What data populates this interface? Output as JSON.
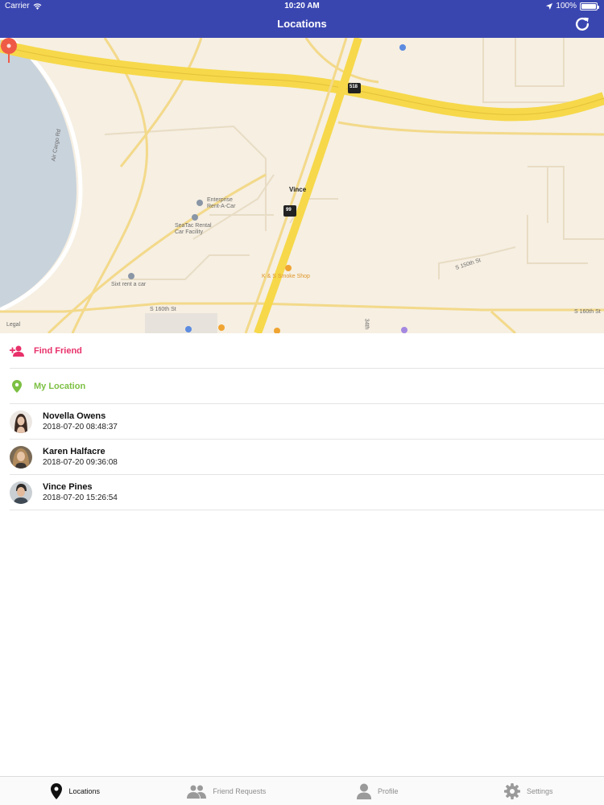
{
  "status_bar": {
    "carrier": "Carrier",
    "time": "10:20 AM",
    "battery": "100%"
  },
  "header": {
    "title": "Locations"
  },
  "map": {
    "pin_label": "Vince",
    "legal": "Legal",
    "labels": {
      "air_cargo": "Air Cargo Rd",
      "enterprise": "Enterprise\nRent-A-Car",
      "seatac": "SeaTac Rental\nCar Facility",
      "sixt": "Sixt rent a car",
      "smoke_shop": "K & S Smoke Shop",
      "s160_left": "S 160th St",
      "s160_right": "S 160th St",
      "s150": "S 150th St",
      "st34": "34th",
      "hwy518": "518",
      "hwy99": "99"
    }
  },
  "actions": [
    {
      "label": "Find Friend",
      "color": "#e8316b",
      "icon": "person-add-icon"
    },
    {
      "label": "My Location",
      "color": "#7cc043",
      "icon": "location-pin-icon"
    }
  ],
  "friends": [
    {
      "name": "Novella Owens",
      "timestamp": "2018-07-20 08:48:37"
    },
    {
      "name": "Karen Halfacre",
      "timestamp": "2018-07-20 09:36:08"
    },
    {
      "name": "Vince Pines",
      "timestamp": "2018-07-20 15:26:54"
    }
  ],
  "tabs": [
    {
      "label": "Locations",
      "icon": "map-marker-icon",
      "active": true
    },
    {
      "label": "Friend Requests",
      "icon": "people-icon",
      "active": false
    },
    {
      "label": "Profile",
      "icon": "person-icon",
      "active": false
    },
    {
      "label": "Settings",
      "icon": "gear-icon",
      "active": false
    }
  ],
  "colors": {
    "header": "#3a46b0",
    "highway": "#f6d84a",
    "map_bg": "#f6efe2",
    "water": "#c9d3dc",
    "pin": "#ef5a47"
  }
}
